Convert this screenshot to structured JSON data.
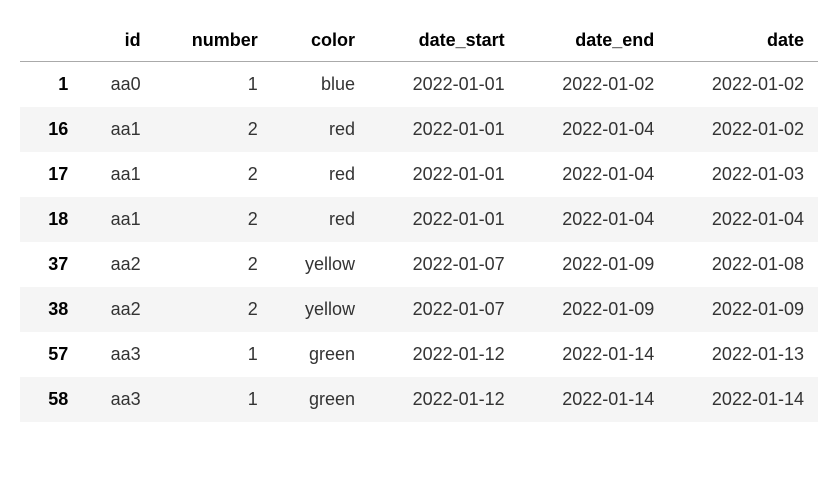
{
  "table": {
    "columns": [
      "",
      "id",
      "number",
      "color",
      "date_start",
      "date_end",
      "date"
    ],
    "rows": [
      {
        "index": "1",
        "id": "aa0",
        "number": "1",
        "color": "blue",
        "date_start": "2022-01-01",
        "date_end": "2022-01-02",
        "date": "2022-01-02"
      },
      {
        "index": "16",
        "id": "aa1",
        "number": "2",
        "color": "red",
        "date_start": "2022-01-01",
        "date_end": "2022-01-04",
        "date": "2022-01-02"
      },
      {
        "index": "17",
        "id": "aa1",
        "number": "2",
        "color": "red",
        "date_start": "2022-01-01",
        "date_end": "2022-01-04",
        "date": "2022-01-03"
      },
      {
        "index": "18",
        "id": "aa1",
        "number": "2",
        "color": "red",
        "date_start": "2022-01-01",
        "date_end": "2022-01-04",
        "date": "2022-01-04"
      },
      {
        "index": "37",
        "id": "aa2",
        "number": "2",
        "color": "yellow",
        "date_start": "2022-01-07",
        "date_end": "2022-01-09",
        "date": "2022-01-08"
      },
      {
        "index": "38",
        "id": "aa2",
        "number": "2",
        "color": "yellow",
        "date_start": "2022-01-07",
        "date_end": "2022-01-09",
        "date": "2022-01-09"
      },
      {
        "index": "57",
        "id": "aa3",
        "number": "1",
        "color": "green",
        "date_start": "2022-01-12",
        "date_end": "2022-01-14",
        "date": "2022-01-13"
      },
      {
        "index": "58",
        "id": "aa3",
        "number": "1",
        "color": "green",
        "date_start": "2022-01-12",
        "date_end": "2022-01-14",
        "date": "2022-01-14"
      }
    ]
  }
}
